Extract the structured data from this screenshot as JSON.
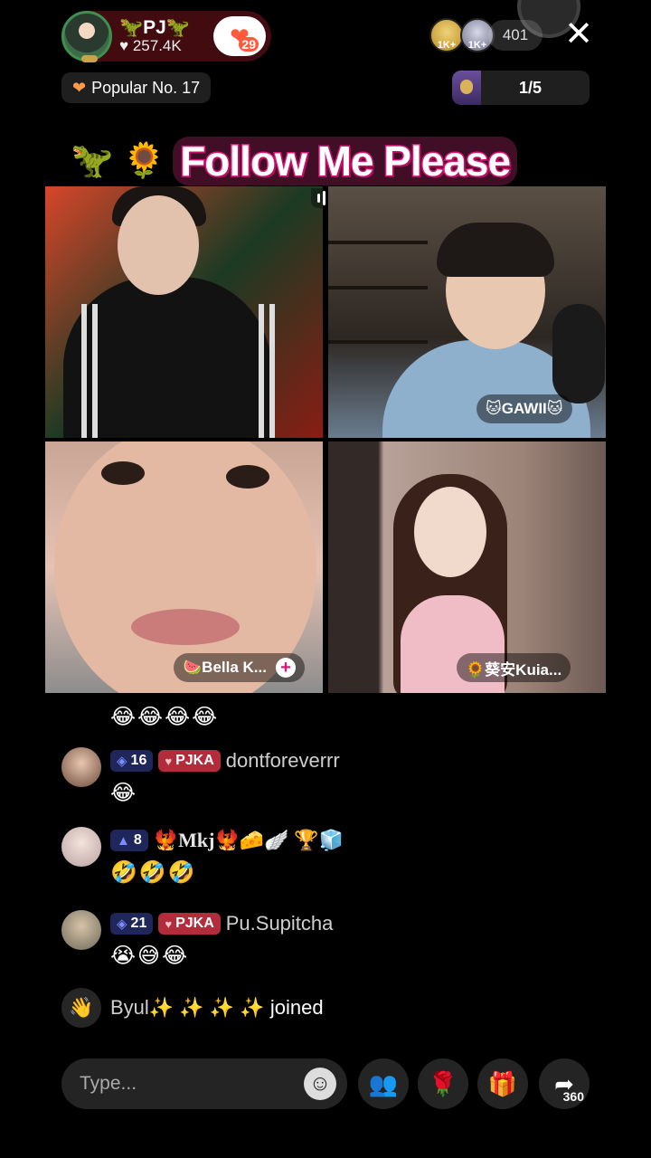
{
  "host": {
    "name": "🦖PJ🦖",
    "likes": "257.4K",
    "fans_level": "29"
  },
  "viewers": {
    "badge1": "1K+",
    "badge2": "1K+",
    "count": "401"
  },
  "close_label": "✕",
  "popular": {
    "label": "Popular No. 17"
  },
  "pagination": {
    "text": "1/5"
  },
  "banner": {
    "emoji": "🦖 🌻",
    "text": "Follow Me Please"
  },
  "guests": [
    {
      "name": ""
    },
    {
      "name": "🐱GAWII🐱"
    },
    {
      "name": "🍉Bella K..."
    },
    {
      "name": "🌻葵安Kuia..."
    }
  ],
  "chat": {
    "top_emojis": "😂😂😂😂",
    "messages": [
      {
        "level": "16",
        "club": "PJKA",
        "user": "dontforeverrr",
        "text": "😂"
      },
      {
        "level": "8",
        "club": "",
        "user": "🐦‍🔥Mkj🐦‍🔥🧀🪽 🏆🧊",
        "text": "🤣🤣🤣"
      },
      {
        "level": "21",
        "club": "PJKA",
        "user": "Pu.Supitcha",
        "text": "😭😅😂"
      }
    ],
    "joined_user": "Byul✨ ✨ ✨ ✨",
    "joined_label": "joined"
  },
  "input": {
    "placeholder": "Type..."
  },
  "share": {
    "count": "360"
  },
  "colors": {
    "banner_stroke": "#e0157a",
    "club_badge": "#b22c3c",
    "level_badge": "#5a6eff"
  }
}
